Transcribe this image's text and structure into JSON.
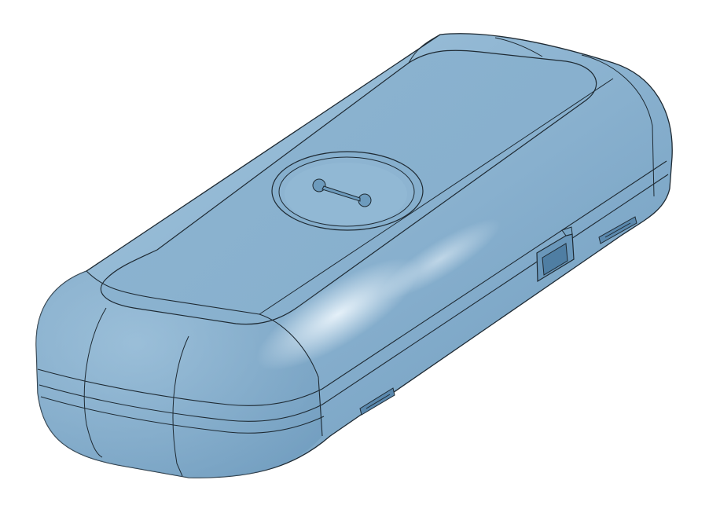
{
  "scene": {
    "subject": "",
    "colors": {
      "background": "#ffffff",
      "body": "#8fb6d2",
      "body_dark": "#5f8db0",
      "body_light": "#cfe3f0",
      "edge": "#1e2a33"
    }
  }
}
